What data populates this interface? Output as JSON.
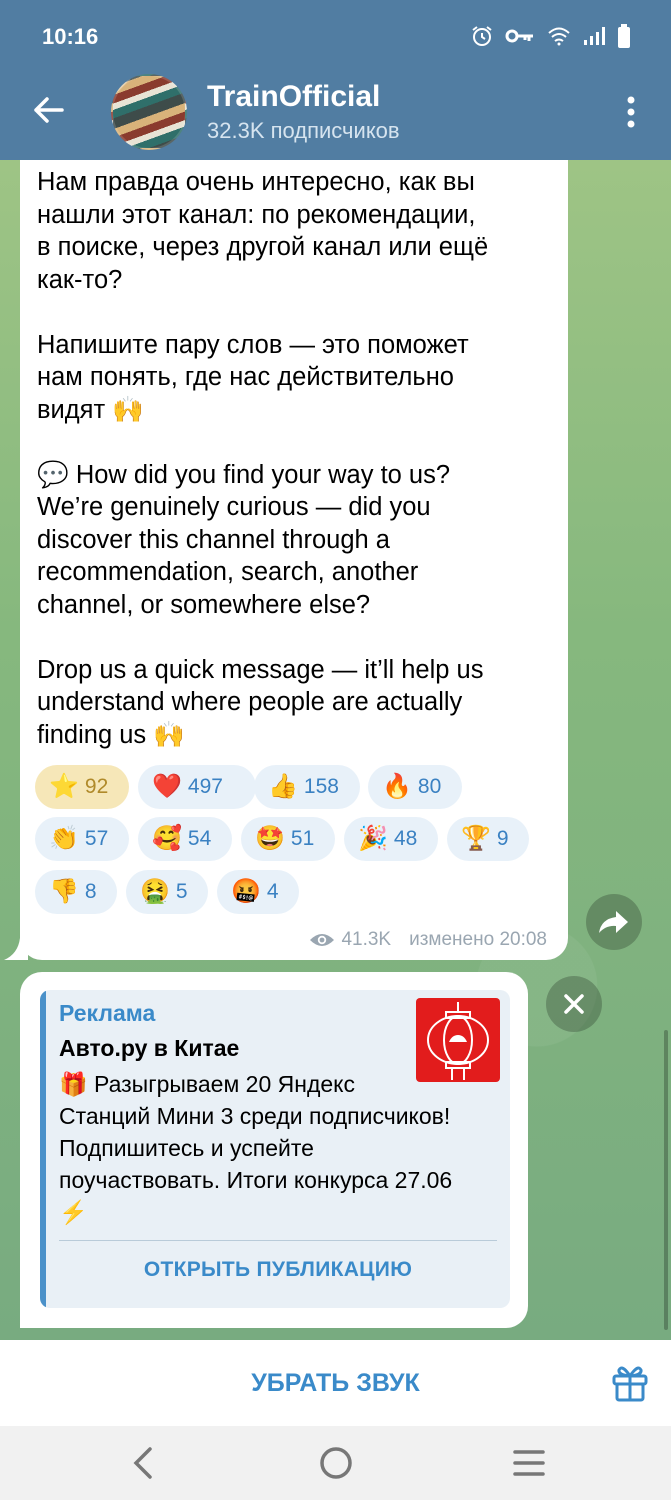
{
  "status_bar": {
    "time": "10:16",
    "icons": [
      "alarm-icon",
      "key-icon",
      "wifi-icon",
      "signal-icon",
      "battery-icon"
    ]
  },
  "header": {
    "title": "TrainOfficial",
    "subtitle": "32.3K подписчиков",
    "back_icon": "arrow-left-icon",
    "menu_icon": "more-vertical-icon",
    "background": "#517da2"
  },
  "message": {
    "text_ru_1": "Нам правда очень интересно, как вы\nнашли этот канал: по рекомендации,\nв поиске, через другой канал или ещё\nкак-то?",
    "text_ru_2": "Напишите пару слов — это поможет\nнам понять, где нас действительно\nвидят 🙌",
    "text_en_1": "💬 How did you find your way to us?\nWe’re genuinely curious — did you\ndiscover this channel through a\nrecommendation, search, another\nchannel, or somewhere else?",
    "text_en_2": "Drop us a quick message — it’ll help us\nunderstand where people are actually\nfinding us 🙌",
    "reactions": [
      {
        "emoji": "⭐",
        "count": "92",
        "active": true
      },
      {
        "emoji": "❤️",
        "count": "497"
      },
      {
        "emoji": "👍",
        "count": "158"
      },
      {
        "emoji": "🔥",
        "count": "80"
      },
      {
        "emoji": "👏",
        "count": "57"
      },
      {
        "emoji": "🥰",
        "count": "54"
      },
      {
        "emoji": "🤩",
        "count": "51"
      },
      {
        "emoji": "🎉",
        "count": "48"
      },
      {
        "emoji": "🏆",
        "count": "9"
      },
      {
        "emoji": "👎",
        "count": "8"
      },
      {
        "emoji": "🤮",
        "count": "5"
      },
      {
        "emoji": "🤬",
        "count": "4"
      }
    ],
    "views": "41.3K",
    "edited": "изменено 20:08"
  },
  "ad": {
    "label": "Реклама",
    "title": "Авто.ру в Китае",
    "body": "🎁 Разыгрываем 20 Яндекс\nСтанций Мини 3 среди подписчиков!\nПодпишитесь и успейте\nпоучаствовать. Итоги конкурса 27.06\n⚡",
    "open_button": "ОТКРЫТЬ ПУБЛИКАЦИЮ",
    "accent": "#3a8ac9"
  },
  "bottom": {
    "mute_label": "УБРАТЬ ЗВУК",
    "gift_icon": "gift-icon"
  },
  "nav": {
    "back": "nav-back-icon",
    "home": "nav-home-icon",
    "recents": "nav-recents-icon"
  }
}
